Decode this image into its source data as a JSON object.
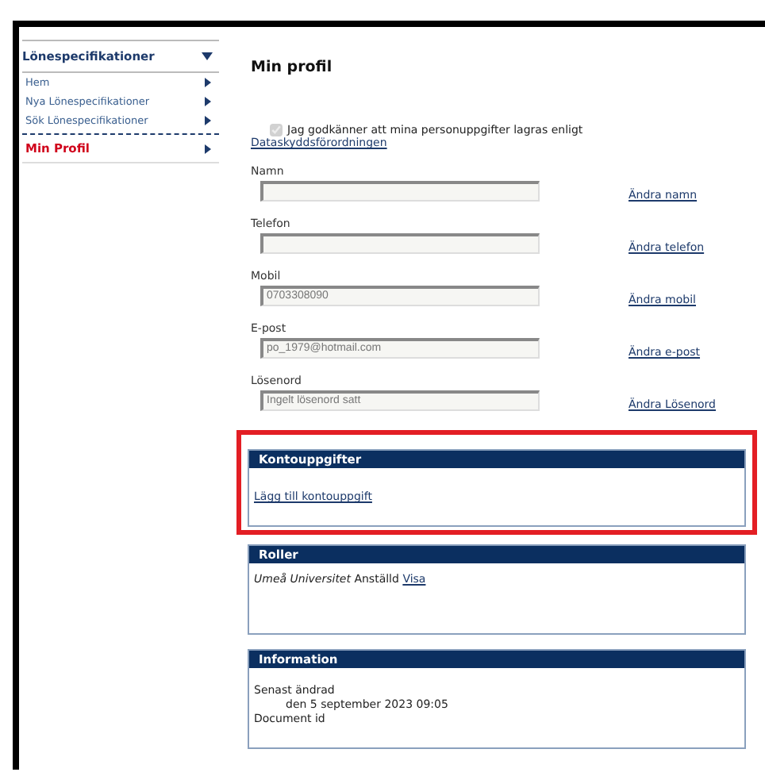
{
  "sidebar": {
    "title": "Lönespecifikationer",
    "expanded": true,
    "items": [
      {
        "label": "Hem",
        "selected": false
      },
      {
        "label": "Nya Lönespecifikationer",
        "selected": false
      },
      {
        "label": "Sök Lönespecifikationer",
        "selected": false
      },
      {
        "label": "Min Profil",
        "selected": true
      }
    ]
  },
  "page_title": "Min profil",
  "consent": {
    "checked": true,
    "disabled": true,
    "label": "Jag godkänner att mina personuppgifter lagras enligt",
    "link": "Dataskyddsförordningen"
  },
  "fields": [
    {
      "label": "Namn",
      "link": "Ändra namn"
    },
    {
      "label": "Telefon",
      "link": "Ändra telefon"
    },
    {
      "label": "Mobil",
      "value": "0703308090",
      "link": "Ändra mobil"
    },
    {
      "label": "E-post",
      "value": "po_1979@hotmail.com",
      "link": "Ändra e-post"
    },
    {
      "label": "Lösenord",
      "value": "Ingelt lösenord satt",
      "link": "Ändra Lösenord"
    }
  ],
  "panels": [
    {
      "kind": "links",
      "title": "Kontouppgifter",
      "highlighted": true,
      "link": "Lägg till kontouppgift"
    },
    {
      "kind": "roles",
      "title": "Roller",
      "highlighted": false,
      "text": "*Umeå Universitet* Anställd",
      "link": "Visa"
    },
    {
      "kind": "info",
      "title": "Information",
      "highlighted": false,
      "lines": [
        {
          "text": "Senast ändrad",
          "indented": false
        },
        {
          "text": "den 5 september 2023 09:05",
          "indented": true
        },
        {
          "text": "Document id",
          "indented": false
        }
      ]
    }
  ]
}
